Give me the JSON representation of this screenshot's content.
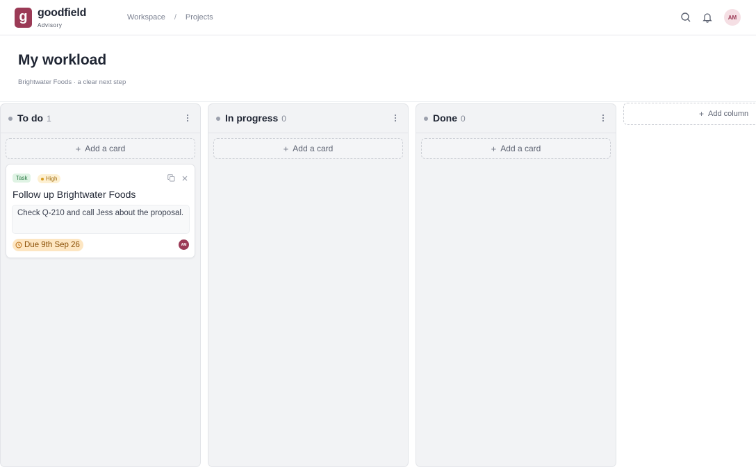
{
  "brand": {
    "logo_letter": "g",
    "name": "goodfield",
    "subtitle": "Advisory",
    "color": "#9b3a56"
  },
  "breadcrumb": {
    "items": [
      "Workspace",
      "Projects"
    ],
    "separator": "/"
  },
  "header_icons": [
    "search-icon",
    "bell-icon"
  ],
  "user": {
    "initials": "AM"
  },
  "page": {
    "title": "My workload",
    "subtitle": "Brightwater Foods · a clear next step"
  },
  "board": {
    "add_card_label": "Add a card",
    "add_column_label": "Add column",
    "columns": [
      {
        "title": "To do",
        "count": "1",
        "cards": [
          {
            "type_tag": "Task",
            "priority": "High",
            "title": "Follow up Brightwater Foods",
            "description": "Check Q-210 and call Jess about the proposal.",
            "due": "Due 9th Sep 26",
            "assignee": "AM"
          }
        ]
      },
      {
        "title": "In progress",
        "count": "0",
        "cards": []
      },
      {
        "title": "Done",
        "count": "0",
        "cards": []
      }
    ]
  },
  "colors": {
    "tag_task_bg": "#dff3e4",
    "tag_high_bg": "#fdf0d2",
    "due_bg": "#fde6c2",
    "column_bg": "#f2f3f5"
  }
}
